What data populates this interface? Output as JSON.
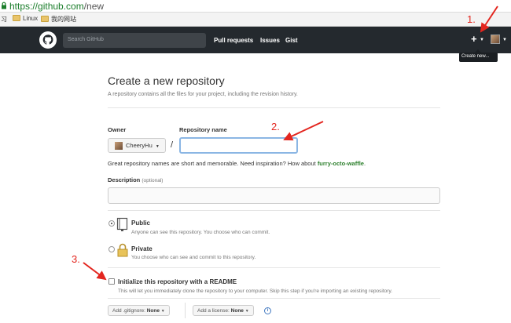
{
  "browser": {
    "url_scheme_host": "https://github.com",
    "url_path": "/new",
    "bookmarks": [
      {
        "label": "习",
        "icon": "none"
      },
      {
        "label": "Linux",
        "icon": "folder-icon"
      },
      {
        "label": "我的网站",
        "icon": "folder-icon"
      }
    ]
  },
  "header": {
    "search_placeholder": "Search GitHub",
    "nav": [
      "Pull requests",
      "Issues",
      "Gist"
    ],
    "plus_label": "+",
    "tooltip": "Create new..."
  },
  "page": {
    "title": "Create a new repository",
    "subtitle": "A repository contains all the files for your project, including the revision history.",
    "owner_label": "Owner",
    "repo_name_label": "Repository name",
    "owner_value": "CheeryHu",
    "slash": "/",
    "repo_name_value": "",
    "hint_prefix": "Great repository names are short and memorable. Need inspiration? How about ",
    "hint_suggestion": "furry-octo-waffle",
    "hint_suffix": ".",
    "description_label": "Description",
    "description_optional": "(optional)",
    "description_value": "",
    "public_title": "Public",
    "public_desc": "Anyone can see this repository. You choose who can commit.",
    "private_title": "Private",
    "private_desc": "You choose who can see and commit to this repository.",
    "readme_title": "Initialize this repository with a README",
    "readme_desc": "This will let you immediately clone the repository to your computer. Skip this step if you're importing an existing repository.",
    "gitignore_label": "Add .gitignore:",
    "gitignore_value": "None",
    "license_label": "Add a license:",
    "license_value": "None",
    "info_glyph": "i"
  },
  "annotations": {
    "a1": "1.",
    "a2": "2.",
    "a3": "3.",
    "color": "#e3261f"
  },
  "colors": {
    "header_bg": "#24292e",
    "suggestion_green": "#2c7f2c",
    "url_green": "#1a7d2a"
  }
}
